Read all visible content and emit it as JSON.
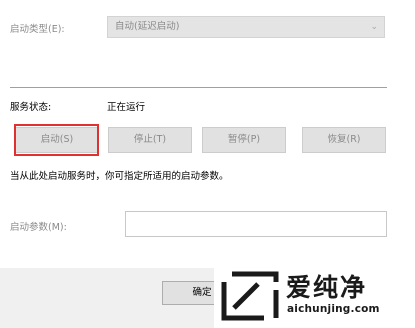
{
  "startup_type": {
    "label": "启动类型(E):",
    "value": "自动(延迟启动)"
  },
  "service_status": {
    "label": "服务状态:",
    "value": "正在运行"
  },
  "buttons": {
    "start": "启动(S)",
    "stop": "停止(T)",
    "pause": "暂停(P)",
    "resume": "恢复(R)"
  },
  "hint": "当从此处启动服务时，你可指定所适用的启动参数。",
  "start_params": {
    "label": "启动参数(M):",
    "value": ""
  },
  "footer": {
    "ok": "确定"
  },
  "watermark": {
    "title": "爱纯净",
    "url": "aichunjing.com"
  },
  "colors": {
    "highlight": "#e03030",
    "disabled_text": "#8a8a8a",
    "button_bg": "#e1e1e1"
  }
}
